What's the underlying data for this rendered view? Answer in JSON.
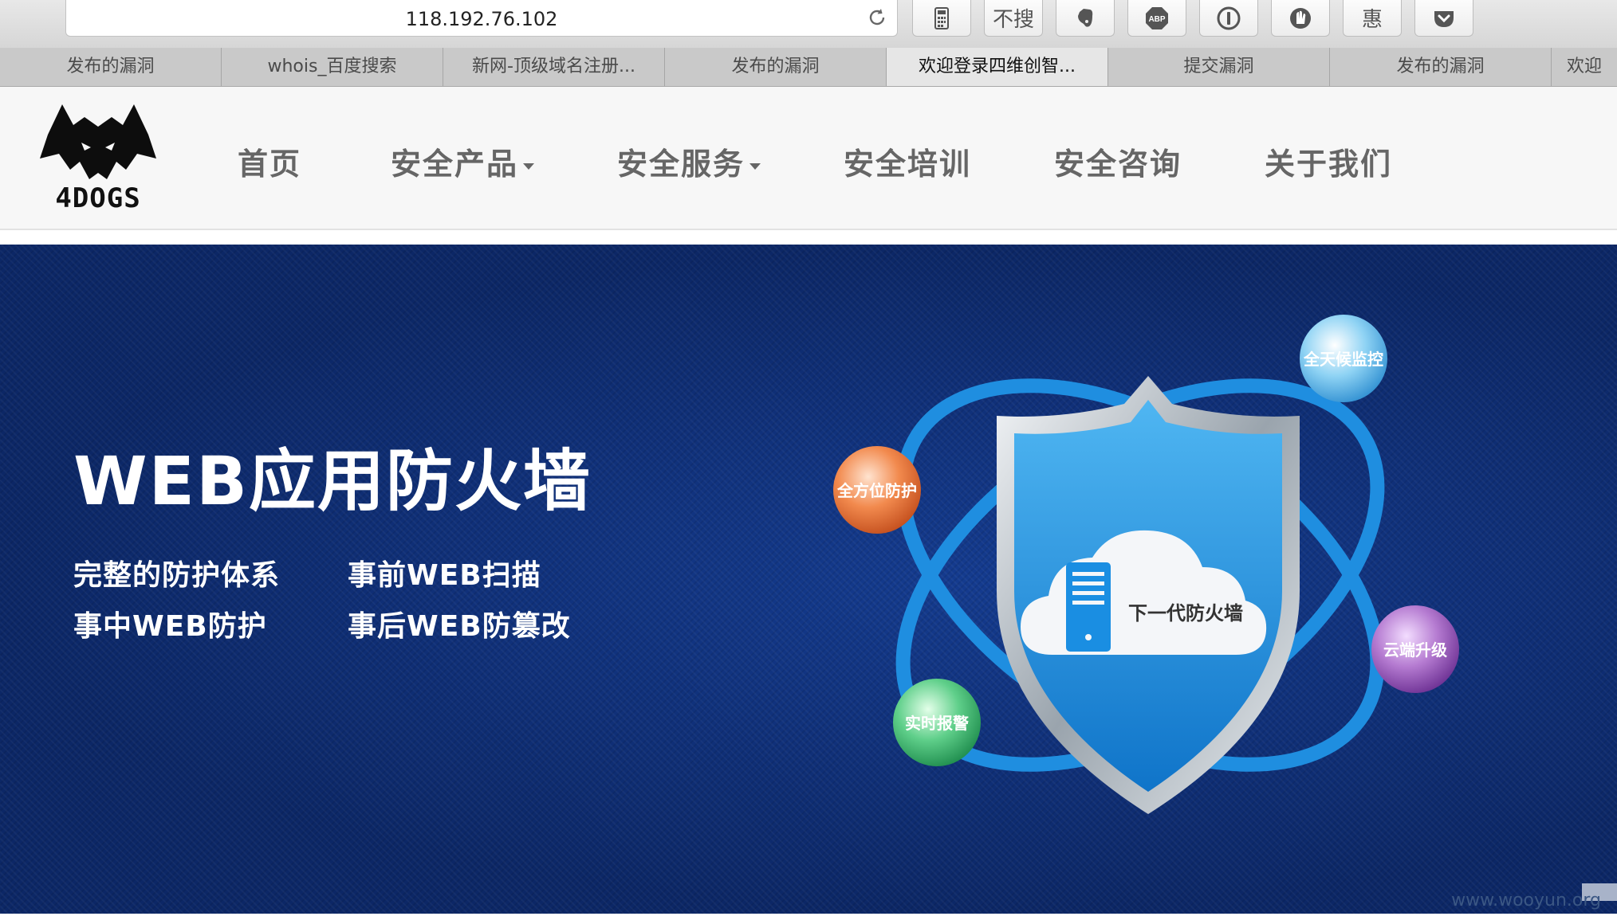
{
  "browser": {
    "url": "118.192.76.102",
    "extensions": [
      {
        "name": "calculator-icon"
      },
      {
        "name": "translate-icon",
        "label": "不搜"
      },
      {
        "name": "evernote-icon"
      },
      {
        "name": "adblock-icon",
        "label": "ABP"
      },
      {
        "name": "onepassword-icon"
      },
      {
        "name": "ghostery-icon"
      },
      {
        "name": "coupon-icon",
        "label": "惠"
      },
      {
        "name": "pocket-icon"
      }
    ],
    "tabs": [
      {
        "label": "发布的漏洞"
      },
      {
        "label": "whois_百度搜索"
      },
      {
        "label": "新网-顶级域名注册..."
      },
      {
        "label": "发布的漏洞"
      },
      {
        "label": "欢迎登录四维创智...",
        "active": true
      },
      {
        "label": "提交漏洞"
      },
      {
        "label": "发布的漏洞"
      },
      {
        "label": "欢迎"
      }
    ]
  },
  "site": {
    "logo_text": "4DOGS",
    "nav": [
      {
        "label": "首页"
      },
      {
        "label": "安全产品",
        "dropdown": true
      },
      {
        "label": "安全服务",
        "dropdown": true
      },
      {
        "label": "安全培训"
      },
      {
        "label": "安全咨询"
      },
      {
        "label": "关于我们"
      }
    ]
  },
  "hero": {
    "title": "WEB应用防火墙",
    "features": [
      "完整的防护体系",
      "事前WEB扫描",
      "事中WEB防护",
      "事后WEB防篡改"
    ],
    "shield_label": "下一代防火墙",
    "orbs": [
      {
        "label": "全天候监控",
        "color": "#8fd3f4"
      },
      {
        "label": "全方位防护",
        "color": "#f28a4e"
      },
      {
        "label": "云端升级",
        "color": "#b57bd1"
      },
      {
        "label": "实时报警",
        "color": "#5fcf8a"
      }
    ],
    "colors": {
      "background": "#0f3079",
      "orbit": "#1f8ee0",
      "shield": "#1a8fe3"
    }
  },
  "watermark": "www.wooyun.org"
}
